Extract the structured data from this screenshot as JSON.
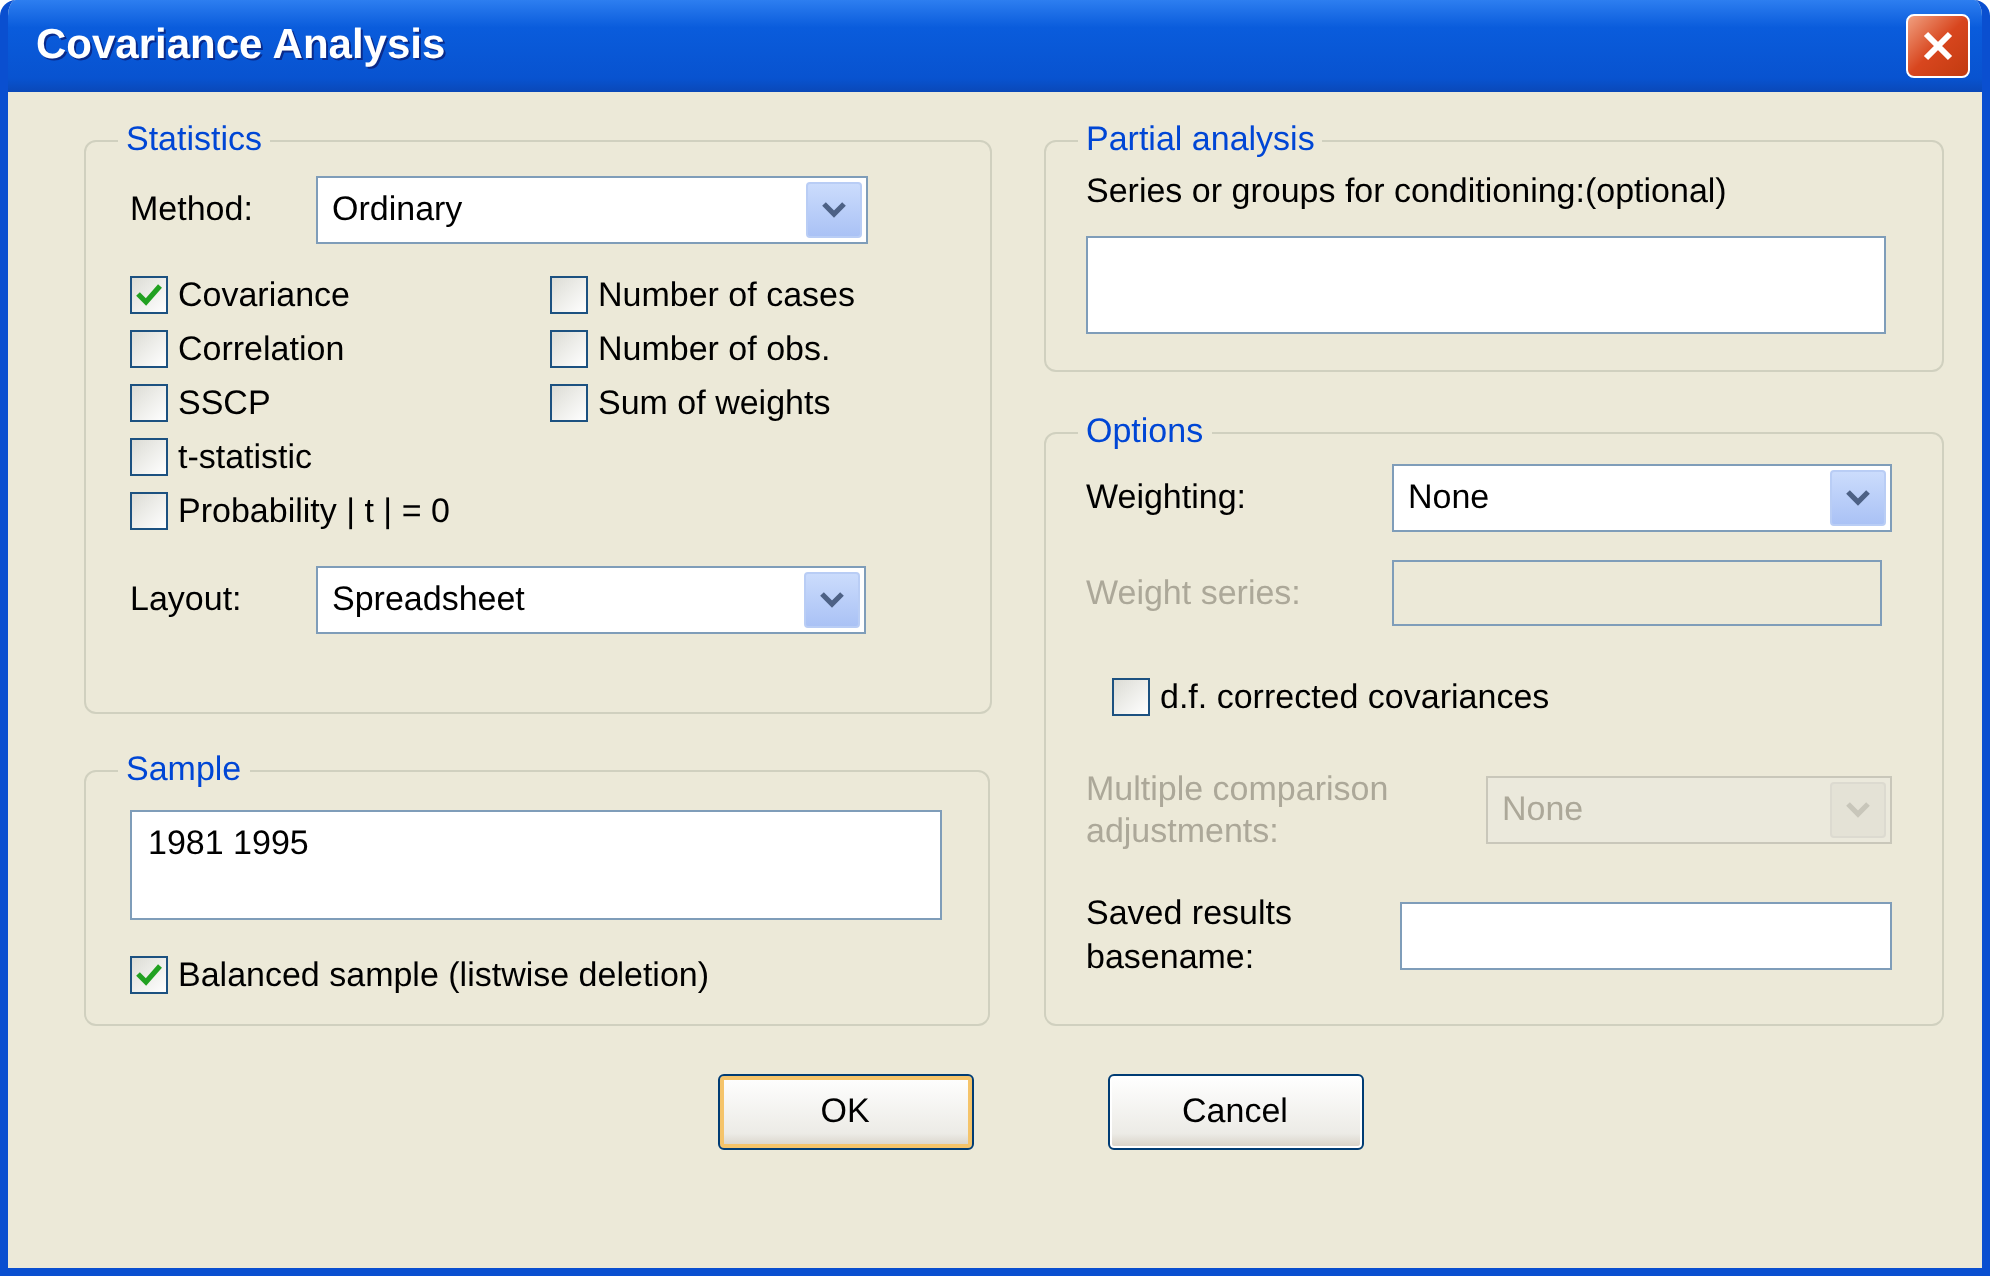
{
  "window": {
    "title": "Covariance Analysis"
  },
  "statistics": {
    "legend": "Statistics",
    "method": {
      "label": "Method:",
      "value": "Ordinary"
    },
    "checks": [
      {
        "label": "Covariance",
        "checked": true
      },
      {
        "label": "Correlation",
        "checked": false
      },
      {
        "label": "SSCP",
        "checked": false
      },
      {
        "label": "t-statistic",
        "checked": false
      },
      {
        "label": "Probability | t | = 0",
        "checked": false
      },
      {
        "label": "Number of cases",
        "checked": false
      },
      {
        "label": "Number of obs.",
        "checked": false
      },
      {
        "label": "Sum of weights",
        "checked": false
      }
    ],
    "layout": {
      "label": "Layout:",
      "value": "Spreadsheet"
    }
  },
  "sample": {
    "legend": "Sample",
    "value": "1981 1995",
    "balanced": {
      "label": "Balanced sample (listwise deletion)",
      "checked": true
    }
  },
  "partial": {
    "legend": "Partial analysis",
    "label": "Series or groups for conditioning:(optional)"
  },
  "options": {
    "legend": "Options",
    "weighting": {
      "label": "Weighting:",
      "value": "None"
    },
    "weight_series": {
      "label": "Weight series:",
      "disabled": true
    },
    "df_corrected": {
      "label": "d.f. corrected covariances",
      "checked": false
    },
    "multiple": {
      "label": "Multiple comparison adjustments:",
      "value": "None",
      "disabled": true
    },
    "saved": {
      "label": "Saved results basename:"
    }
  },
  "buttons": [
    {
      "label": "OK",
      "default": true
    },
    {
      "label": "Cancel",
      "default": false
    }
  ]
}
